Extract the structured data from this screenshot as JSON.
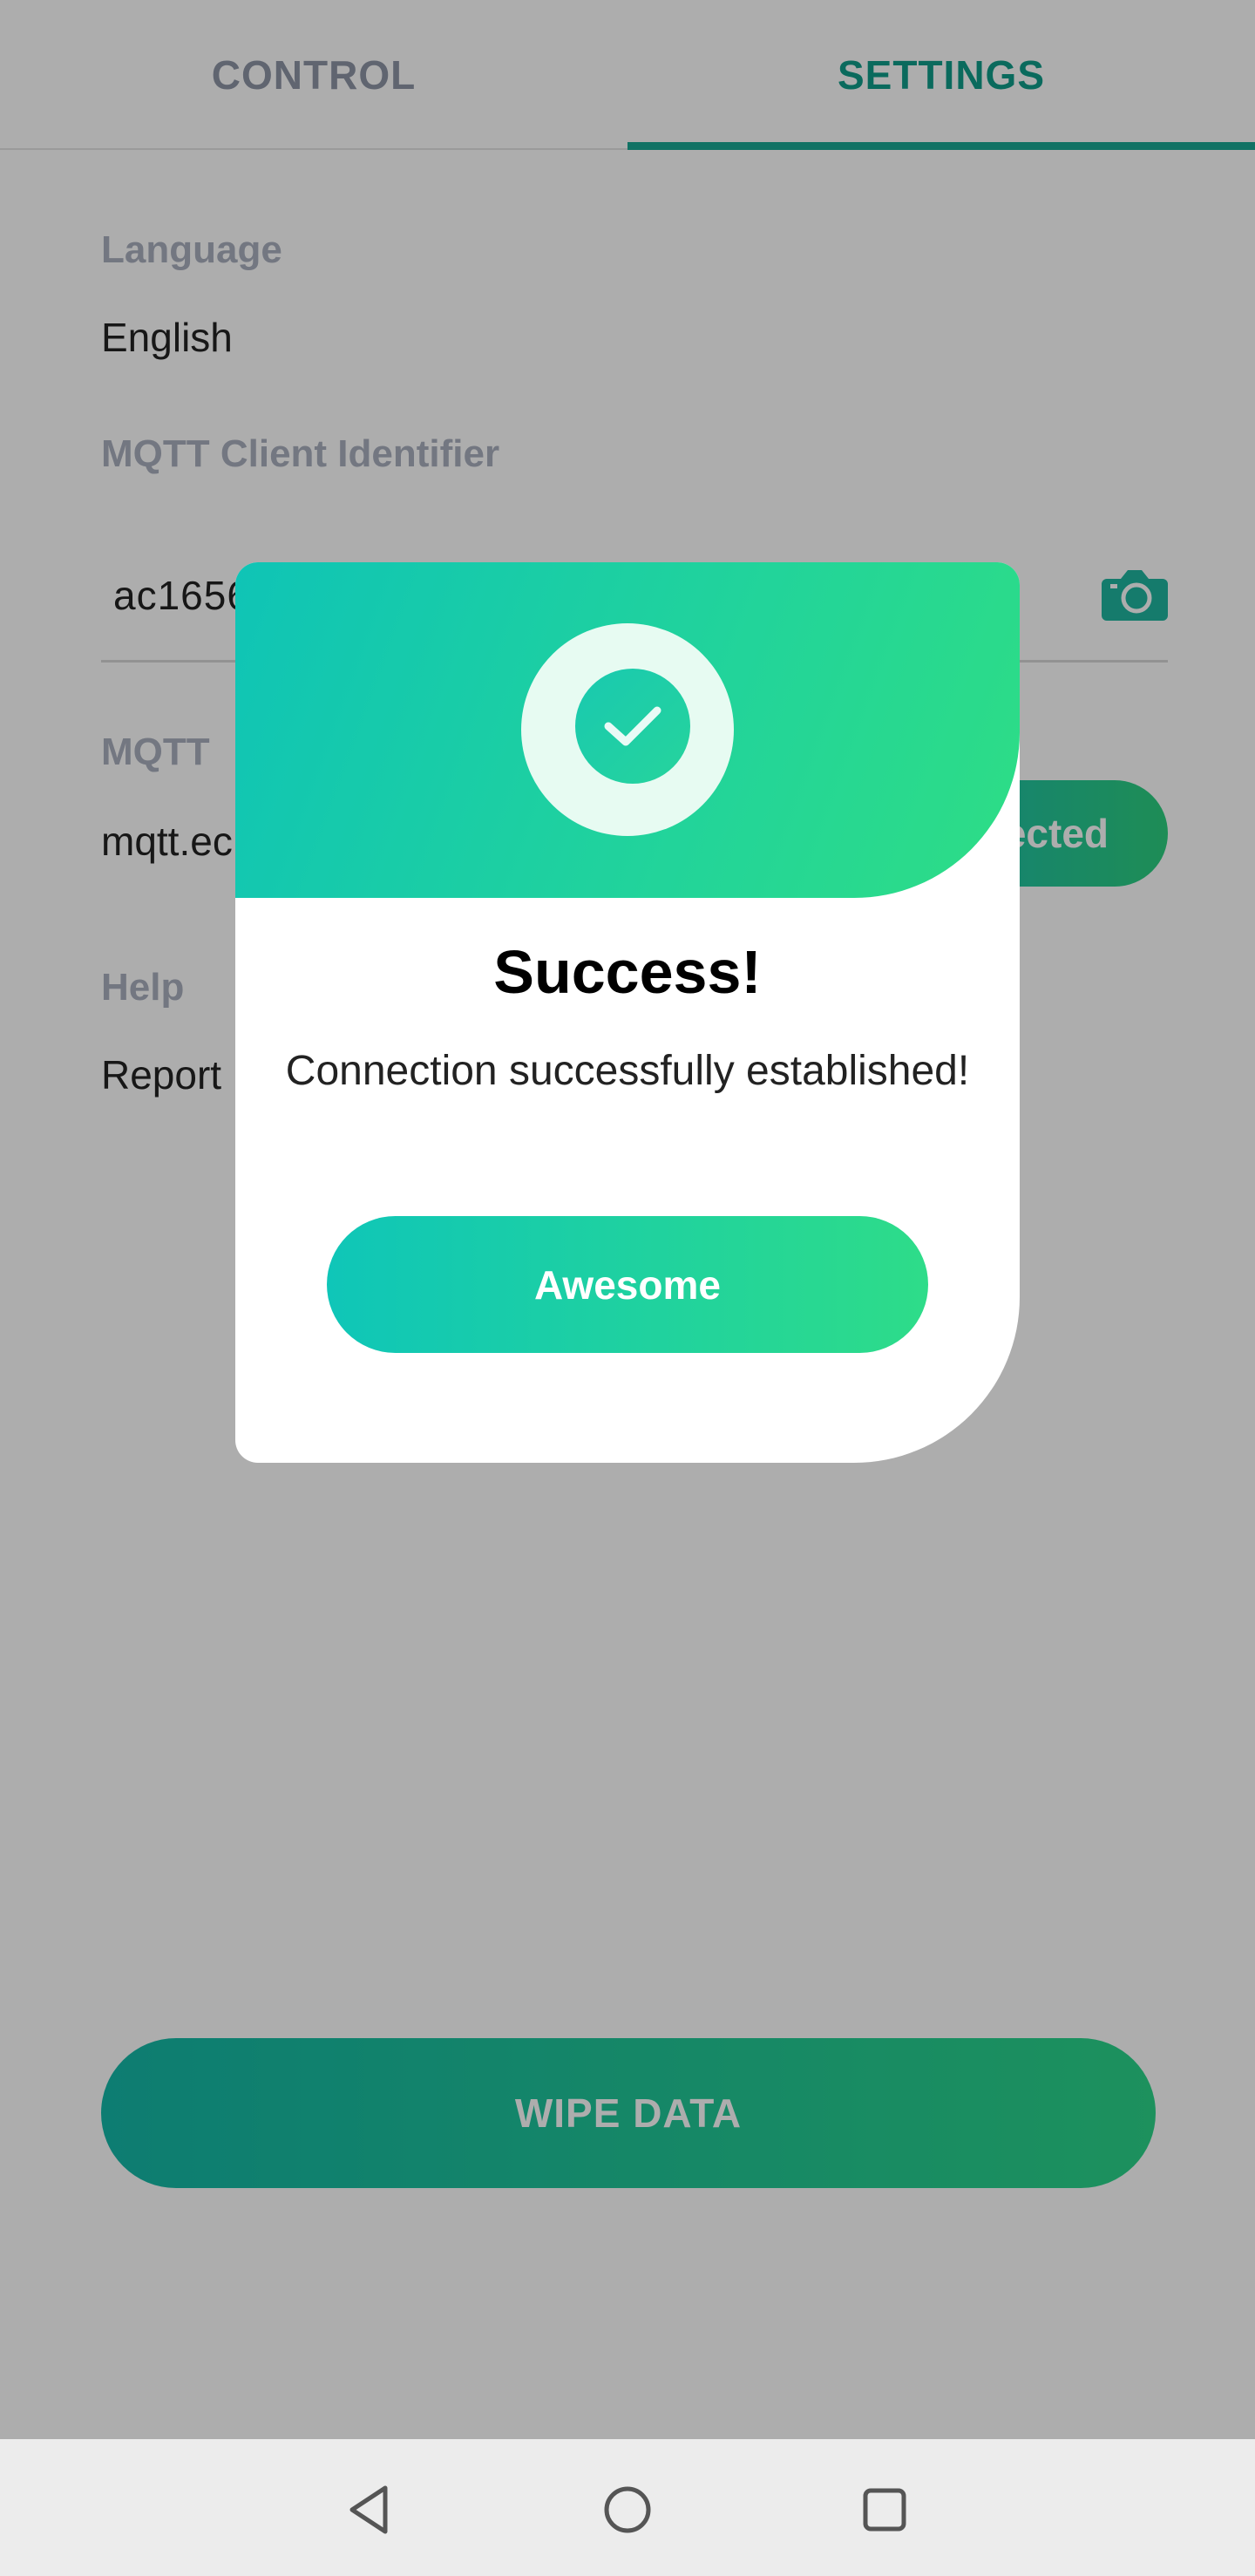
{
  "tabs": [
    {
      "label": "CONTROL",
      "active": false
    },
    {
      "label": "SETTINGS",
      "active": true
    }
  ],
  "settings": {
    "language_label": "Language",
    "language_value": "English",
    "client_id_label": "MQTT Client Identifier",
    "client_id_value": "ac1656f4-c1",
    "broker_label": "MQTT",
    "broker_value": "mqtt.ec",
    "connection_button": "Connected",
    "help_label": "Help",
    "help_value": "Report",
    "wipe_button": "WIPE DATA"
  },
  "dialog": {
    "icon": "check-circle-icon",
    "title": "Success!",
    "message": "Connection successfully established!",
    "button": "Awesome"
  },
  "colors": {
    "accent": "#1aa894",
    "gradient_start": "#0fc6b8",
    "gradient_end": "#2edc89"
  },
  "navbar": {
    "icons": [
      "back-icon",
      "home-icon",
      "recents-icon"
    ]
  }
}
